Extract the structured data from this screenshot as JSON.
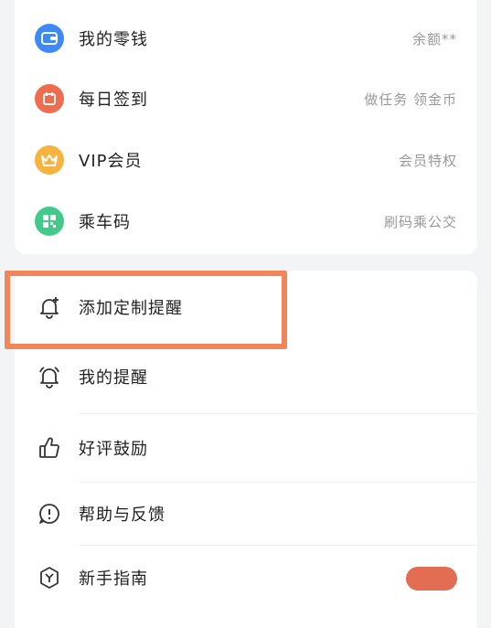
{
  "wallet_section": {
    "items": [
      {
        "label": "我的零钱",
        "right": "余额**",
        "icon": "wallet-icon",
        "color": "#3d8af7"
      },
      {
        "label": "每日签到",
        "right": "做任务 领金币",
        "icon": "checkin-icon",
        "color": "#ef6c4e"
      },
      {
        "label": "VIP会员",
        "right": "会员特权",
        "icon": "crown-icon",
        "color": "#f6b33f"
      },
      {
        "label": "乘车码",
        "right": "刷码乘公交",
        "icon": "qrcode-icon",
        "color": "#43c98a"
      }
    ]
  },
  "menu_section": {
    "items": [
      {
        "label": "添加定制提醒",
        "icon": "bell-plus-icon"
      },
      {
        "label": "我的提醒",
        "icon": "alarm-bell-icon"
      },
      {
        "label": "好评鼓励",
        "icon": "thumbs-up-icon"
      },
      {
        "label": "帮助与反馈",
        "icon": "exclamation-bubble-icon"
      },
      {
        "label": "新手指南",
        "icon": "hexagon-y-icon"
      }
    ]
  },
  "colors": {
    "highlight": "#f0875a",
    "badge": "#e36d52"
  }
}
